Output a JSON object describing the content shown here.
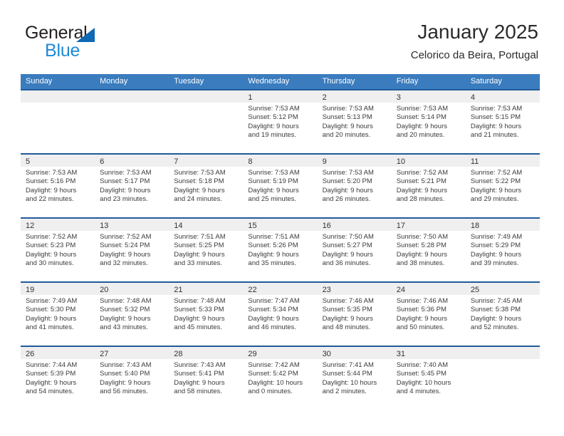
{
  "brand": {
    "name_part1": "General",
    "name_part2": "Blue",
    "accent_color": "#1f8ad6",
    "triangle_color": "#1069b4"
  },
  "header": {
    "title": "January 2025",
    "subtitle": "Celorico da Beira, Portugal"
  },
  "theme": {
    "header_row_bg": "#3a7cbe",
    "week_divider": "#205c9a",
    "day_band_bg": "#efefef",
    "text_color": "#3b3b3b"
  },
  "weekdays": [
    "Sunday",
    "Monday",
    "Tuesday",
    "Wednesday",
    "Thursday",
    "Friday",
    "Saturday"
  ],
  "weeks": [
    [
      {
        "day": "",
        "empty": true,
        "lines": []
      },
      {
        "day": "",
        "empty": true,
        "lines": []
      },
      {
        "day": "",
        "empty": true,
        "lines": []
      },
      {
        "day": "1",
        "empty": false,
        "lines": [
          "Sunrise: 7:53 AM",
          "Sunset: 5:12 PM",
          "Daylight: 9 hours",
          "and 19 minutes."
        ]
      },
      {
        "day": "2",
        "empty": false,
        "lines": [
          "Sunrise: 7:53 AM",
          "Sunset: 5:13 PM",
          "Daylight: 9 hours",
          "and 20 minutes."
        ]
      },
      {
        "day": "3",
        "empty": false,
        "lines": [
          "Sunrise: 7:53 AM",
          "Sunset: 5:14 PM",
          "Daylight: 9 hours",
          "and 20 minutes."
        ]
      },
      {
        "day": "4",
        "empty": false,
        "lines": [
          "Sunrise: 7:53 AM",
          "Sunset: 5:15 PM",
          "Daylight: 9 hours",
          "and 21 minutes."
        ]
      }
    ],
    [
      {
        "day": "5",
        "empty": false,
        "lines": [
          "Sunrise: 7:53 AM",
          "Sunset: 5:16 PM",
          "Daylight: 9 hours",
          "and 22 minutes."
        ]
      },
      {
        "day": "6",
        "empty": false,
        "lines": [
          "Sunrise: 7:53 AM",
          "Sunset: 5:17 PM",
          "Daylight: 9 hours",
          "and 23 minutes."
        ]
      },
      {
        "day": "7",
        "empty": false,
        "lines": [
          "Sunrise: 7:53 AM",
          "Sunset: 5:18 PM",
          "Daylight: 9 hours",
          "and 24 minutes."
        ]
      },
      {
        "day": "8",
        "empty": false,
        "lines": [
          "Sunrise: 7:53 AM",
          "Sunset: 5:19 PM",
          "Daylight: 9 hours",
          "and 25 minutes."
        ]
      },
      {
        "day": "9",
        "empty": false,
        "lines": [
          "Sunrise: 7:53 AM",
          "Sunset: 5:20 PM",
          "Daylight: 9 hours",
          "and 26 minutes."
        ]
      },
      {
        "day": "10",
        "empty": false,
        "lines": [
          "Sunrise: 7:52 AM",
          "Sunset: 5:21 PM",
          "Daylight: 9 hours",
          "and 28 minutes."
        ]
      },
      {
        "day": "11",
        "empty": false,
        "lines": [
          "Sunrise: 7:52 AM",
          "Sunset: 5:22 PM",
          "Daylight: 9 hours",
          "and 29 minutes."
        ]
      }
    ],
    [
      {
        "day": "12",
        "empty": false,
        "lines": [
          "Sunrise: 7:52 AM",
          "Sunset: 5:23 PM",
          "Daylight: 9 hours",
          "and 30 minutes."
        ]
      },
      {
        "day": "13",
        "empty": false,
        "lines": [
          "Sunrise: 7:52 AM",
          "Sunset: 5:24 PM",
          "Daylight: 9 hours",
          "and 32 minutes."
        ]
      },
      {
        "day": "14",
        "empty": false,
        "lines": [
          "Sunrise: 7:51 AM",
          "Sunset: 5:25 PM",
          "Daylight: 9 hours",
          "and 33 minutes."
        ]
      },
      {
        "day": "15",
        "empty": false,
        "lines": [
          "Sunrise: 7:51 AM",
          "Sunset: 5:26 PM",
          "Daylight: 9 hours",
          "and 35 minutes."
        ]
      },
      {
        "day": "16",
        "empty": false,
        "lines": [
          "Sunrise: 7:50 AM",
          "Sunset: 5:27 PM",
          "Daylight: 9 hours",
          "and 36 minutes."
        ]
      },
      {
        "day": "17",
        "empty": false,
        "lines": [
          "Sunrise: 7:50 AM",
          "Sunset: 5:28 PM",
          "Daylight: 9 hours",
          "and 38 minutes."
        ]
      },
      {
        "day": "18",
        "empty": false,
        "lines": [
          "Sunrise: 7:49 AM",
          "Sunset: 5:29 PM",
          "Daylight: 9 hours",
          "and 39 minutes."
        ]
      }
    ],
    [
      {
        "day": "19",
        "empty": false,
        "lines": [
          "Sunrise: 7:49 AM",
          "Sunset: 5:30 PM",
          "Daylight: 9 hours",
          "and 41 minutes."
        ]
      },
      {
        "day": "20",
        "empty": false,
        "lines": [
          "Sunrise: 7:48 AM",
          "Sunset: 5:32 PM",
          "Daylight: 9 hours",
          "and 43 minutes."
        ]
      },
      {
        "day": "21",
        "empty": false,
        "lines": [
          "Sunrise: 7:48 AM",
          "Sunset: 5:33 PM",
          "Daylight: 9 hours",
          "and 45 minutes."
        ]
      },
      {
        "day": "22",
        "empty": false,
        "lines": [
          "Sunrise: 7:47 AM",
          "Sunset: 5:34 PM",
          "Daylight: 9 hours",
          "and 46 minutes."
        ]
      },
      {
        "day": "23",
        "empty": false,
        "lines": [
          "Sunrise: 7:46 AM",
          "Sunset: 5:35 PM",
          "Daylight: 9 hours",
          "and 48 minutes."
        ]
      },
      {
        "day": "24",
        "empty": false,
        "lines": [
          "Sunrise: 7:46 AM",
          "Sunset: 5:36 PM",
          "Daylight: 9 hours",
          "and 50 minutes."
        ]
      },
      {
        "day": "25",
        "empty": false,
        "lines": [
          "Sunrise: 7:45 AM",
          "Sunset: 5:38 PM",
          "Daylight: 9 hours",
          "and 52 minutes."
        ]
      }
    ],
    [
      {
        "day": "26",
        "empty": false,
        "lines": [
          "Sunrise: 7:44 AM",
          "Sunset: 5:39 PM",
          "Daylight: 9 hours",
          "and 54 minutes."
        ]
      },
      {
        "day": "27",
        "empty": false,
        "lines": [
          "Sunrise: 7:43 AM",
          "Sunset: 5:40 PM",
          "Daylight: 9 hours",
          "and 56 minutes."
        ]
      },
      {
        "day": "28",
        "empty": false,
        "lines": [
          "Sunrise: 7:43 AM",
          "Sunset: 5:41 PM",
          "Daylight: 9 hours",
          "and 58 minutes."
        ]
      },
      {
        "day": "29",
        "empty": false,
        "lines": [
          "Sunrise: 7:42 AM",
          "Sunset: 5:42 PM",
          "Daylight: 10 hours",
          "and 0 minutes."
        ]
      },
      {
        "day": "30",
        "empty": false,
        "lines": [
          "Sunrise: 7:41 AM",
          "Sunset: 5:44 PM",
          "Daylight: 10 hours",
          "and 2 minutes."
        ]
      },
      {
        "day": "31",
        "empty": false,
        "lines": [
          "Sunrise: 7:40 AM",
          "Sunset: 5:45 PM",
          "Daylight: 10 hours",
          "and 4 minutes."
        ]
      },
      {
        "day": "",
        "empty": true,
        "lines": []
      }
    ]
  ]
}
